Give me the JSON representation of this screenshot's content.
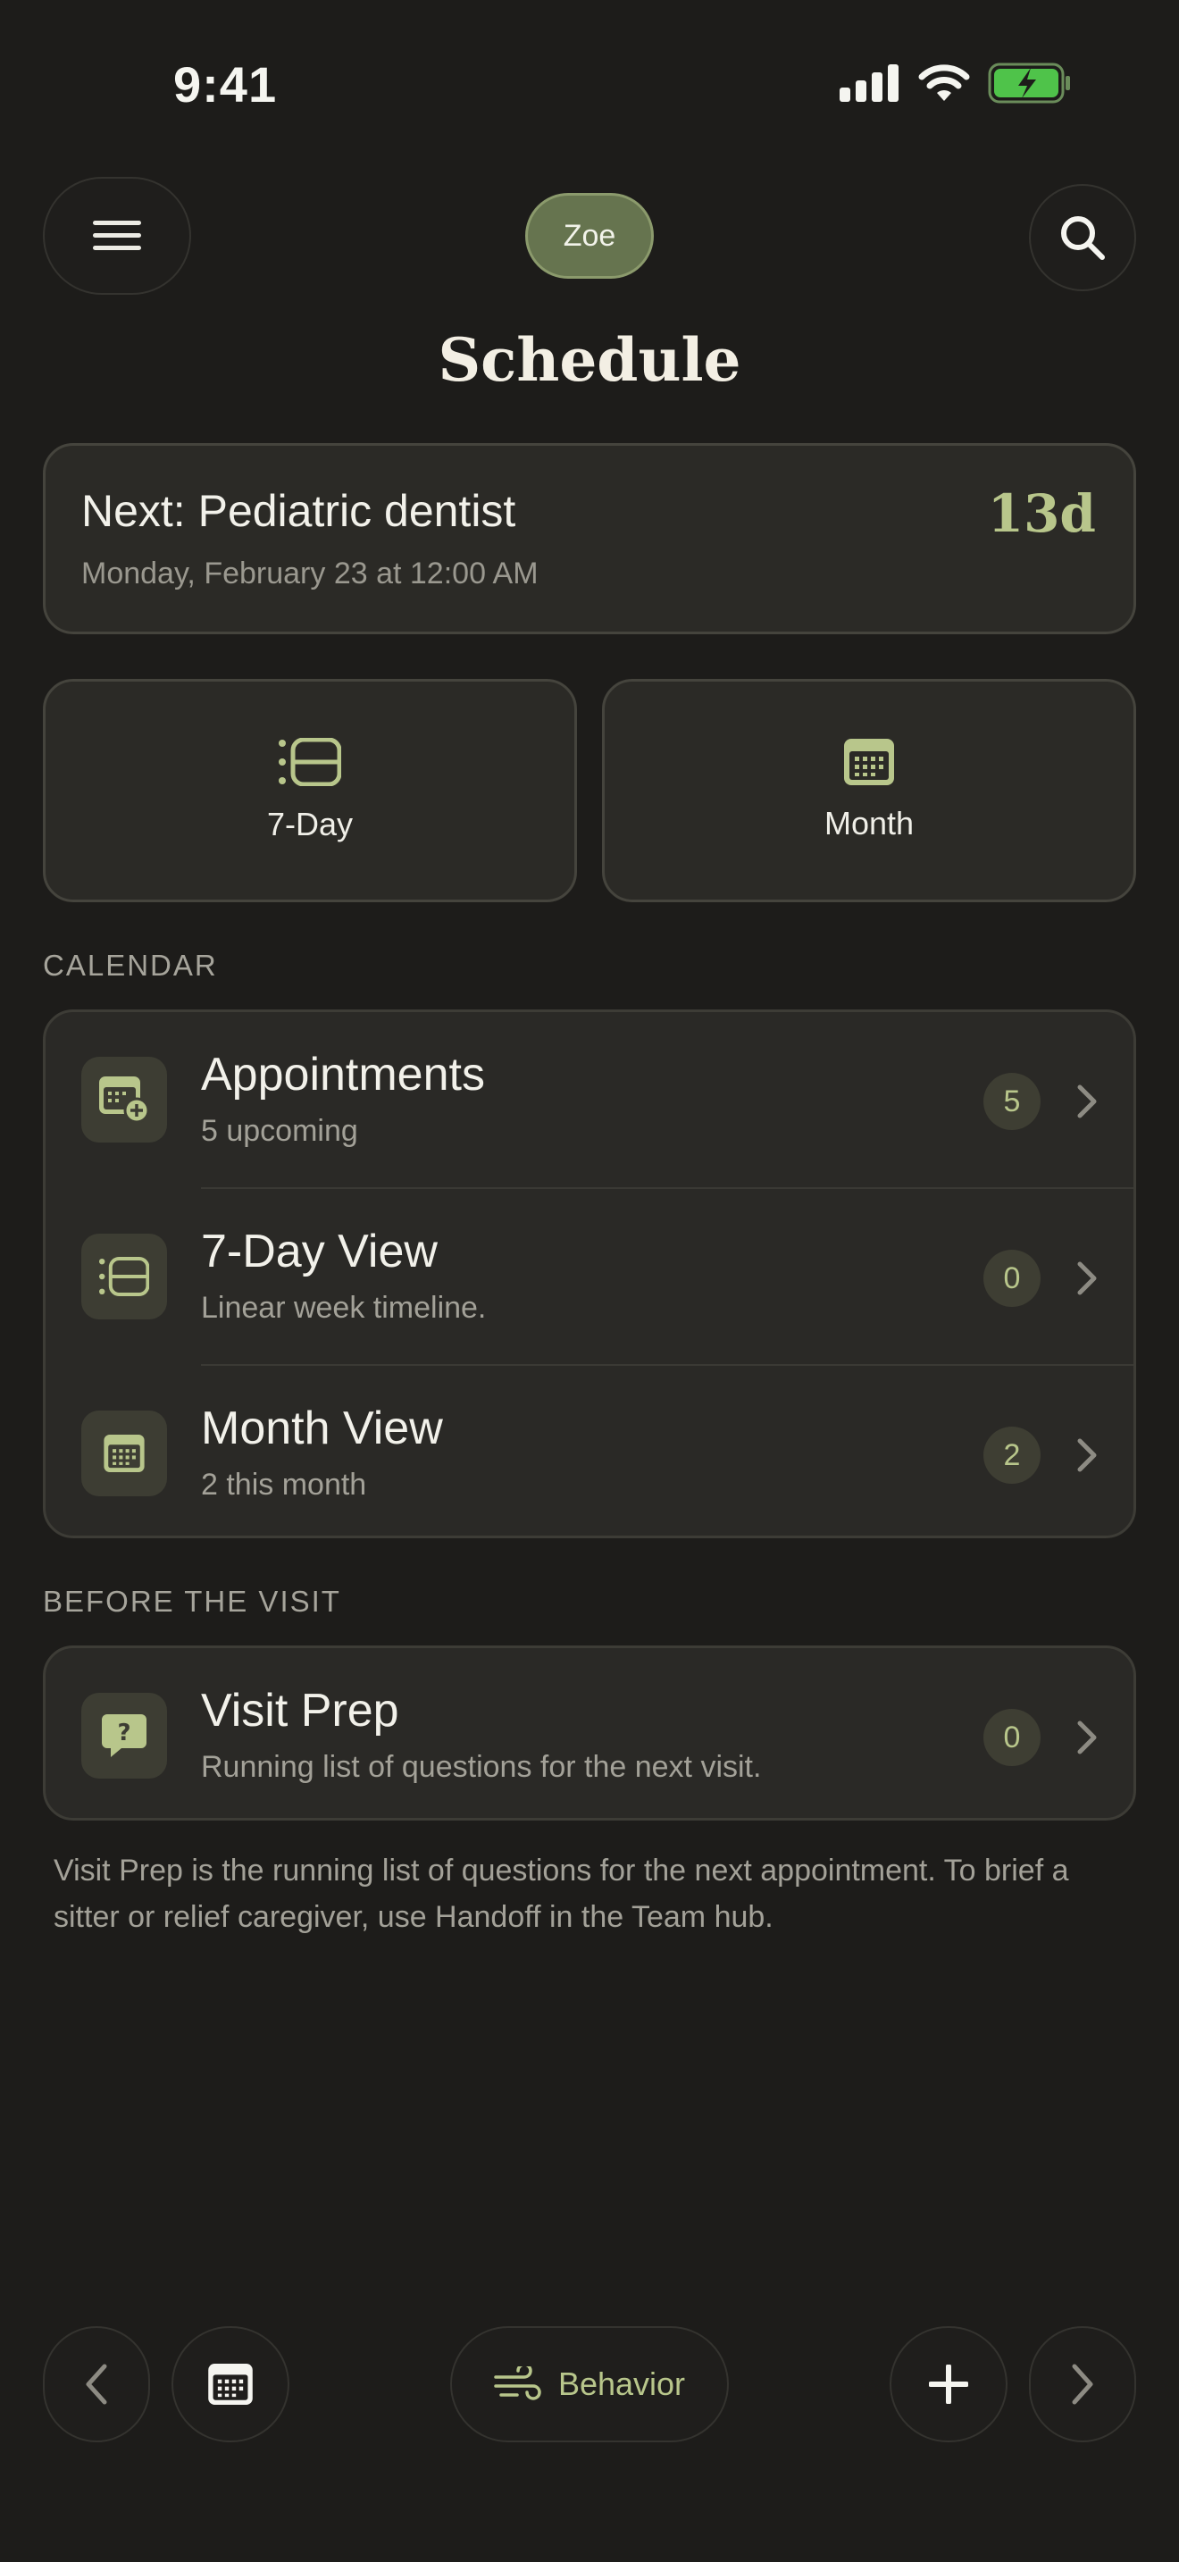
{
  "status_bar": {
    "time": "9:41"
  },
  "header": {
    "profile_name": "Zoe",
    "title": "Schedule"
  },
  "next_up": {
    "title": "Next: Pediatric dentist",
    "subtitle": "Monday, February 23 at 12:00 AM",
    "countdown": "13d"
  },
  "view_tiles": [
    {
      "label": "7-Day",
      "icon": "timeline-icon"
    },
    {
      "label": "Month",
      "icon": "calendar-icon"
    }
  ],
  "calendar_section": {
    "label": "CALENDAR",
    "rows": [
      {
        "title": "Appointments",
        "subtitle": "5 upcoming",
        "badge": "5",
        "icon": "calendar-add-icon"
      },
      {
        "title": "7-Day View",
        "subtitle": "Linear week timeline.",
        "badge": "0",
        "icon": "timeline-icon"
      },
      {
        "title": "Month View",
        "subtitle": "2 this month",
        "badge": "2",
        "icon": "calendar-icon"
      }
    ]
  },
  "before_visit_section": {
    "label": "BEFORE THE VISIT",
    "rows": [
      {
        "title": "Visit Prep",
        "subtitle": "Running list of questions for the next visit.",
        "badge": "0",
        "icon": "question-bubble-icon"
      }
    ]
  },
  "footnote": "Visit Prep is the running list of questions for the next appointment. To brief a sitter or relief caregiver, use Handoff in the Team hub.",
  "bottom_bar": {
    "behavior_label": "Behavior"
  },
  "colors": {
    "accent": "#b8c68b",
    "background": "#1d1c1a",
    "card": "#2b2a26",
    "profile": "#66744f"
  }
}
